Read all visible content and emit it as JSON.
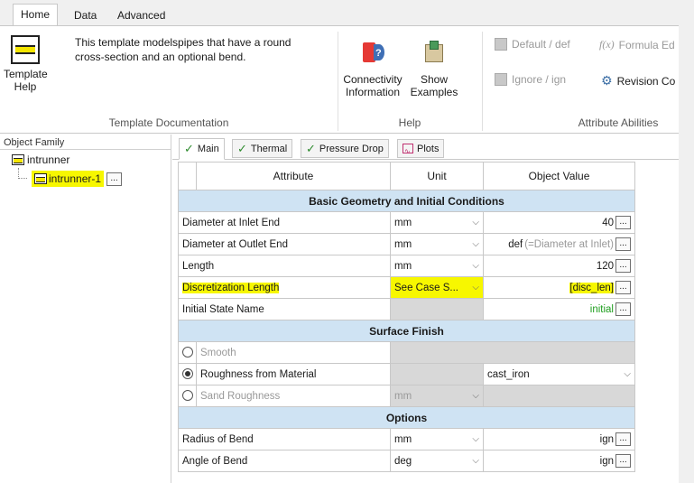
{
  "ribbon_tabs": [
    "Home",
    "Data",
    "Advanced"
  ],
  "template_doc": {
    "description_line1": "This template modelspipes that have a round",
    "description_line2": "cross-section and an optional bend.",
    "button_line1": "Template",
    "button_line2": "Help",
    "group_label": "Template Documentation"
  },
  "help_group": {
    "connectivity_line1": "Connectivity",
    "connectivity_line2": "Information",
    "examples_line1": "Show",
    "examples_line2": "Examples",
    "group_label": "Help"
  },
  "attribute_group": {
    "default": "Default / def",
    "formula": "Formula Ed",
    "ignore": "Ignore / ign",
    "revision": "Revision Co",
    "group_label": "Attribute Abilities"
  },
  "tree": {
    "title": "Object Family",
    "root": "intrunner",
    "child": "intrunner-1",
    "dots": "..."
  },
  "subtabs": [
    "Main",
    "Thermal",
    "Pressure Drop",
    "Plots"
  ],
  "grid": {
    "headers": [
      "Attribute",
      "Unit",
      "Object Value"
    ],
    "sections": {
      "basic": "Basic Geometry and Initial Conditions",
      "surface": "Surface Finish",
      "options": "Options"
    },
    "rows": {
      "inlet": {
        "attr": "Diameter at Inlet End",
        "unit": "mm",
        "value": "40"
      },
      "outlet": {
        "attr": "Diameter at Outlet End",
        "unit": "mm",
        "value": "def",
        "hint": "(=Diameter at Inlet)"
      },
      "length": {
        "attr": "Length",
        "unit": "mm",
        "value": "120"
      },
      "disc": {
        "attr": "Discretization Length",
        "unit": "See Case S...",
        "value": "[disc_len]"
      },
      "initial": {
        "attr": "Initial State Name",
        "value": "initial"
      },
      "smooth": {
        "attr": "Smooth"
      },
      "roughness": {
        "attr": "Roughness from Material",
        "value": "cast_iron"
      },
      "sand": {
        "attr": "Sand Roughness",
        "unit": "mm"
      },
      "radius": {
        "attr": "Radius of Bend",
        "unit": "mm",
        "value": "ign"
      },
      "angle": {
        "attr": "Angle of Bend",
        "unit": "deg",
        "value": "ign"
      }
    },
    "dots": "..."
  }
}
